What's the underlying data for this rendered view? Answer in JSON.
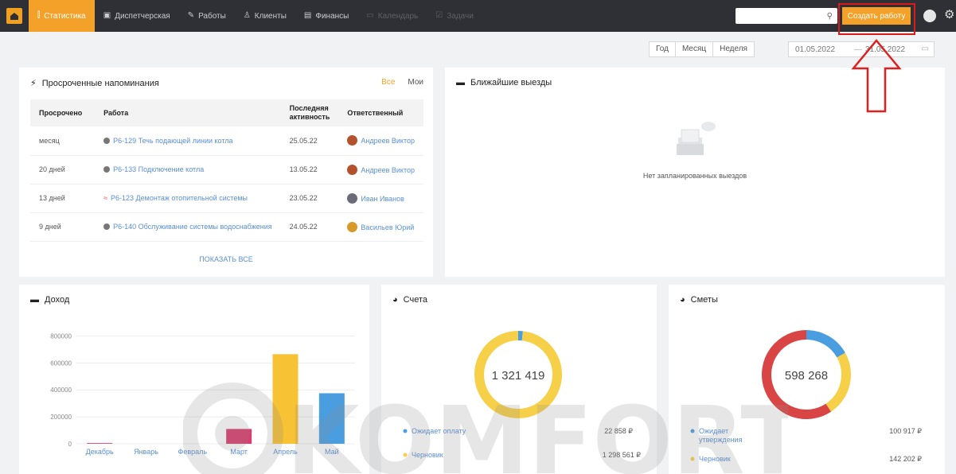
{
  "nav": {
    "items": [
      {
        "label": "Статистика",
        "icon": "chart-icon",
        "glyph": "⫿",
        "active": true
      },
      {
        "label": "Диспетчерская",
        "icon": "dispatch-icon",
        "glyph": "▣"
      },
      {
        "label": "Работы",
        "icon": "wrench-icon",
        "glyph": "✎"
      },
      {
        "label": "Клиенты",
        "icon": "person-icon",
        "glyph": "♙"
      },
      {
        "label": "Финансы",
        "icon": "finance-icon",
        "glyph": "▤"
      },
      {
        "label": "Календарь",
        "icon": "calendar-icon",
        "glyph": "▭",
        "disabled": true
      },
      {
        "label": "Задачи",
        "icon": "tasks-icon",
        "glyph": "☑",
        "disabled": true
      }
    ],
    "search_icon": "⚲",
    "create_label": "Создать работу",
    "gear_glyph": "⚙"
  },
  "filters": {
    "periods": [
      "Год",
      "Месяц",
      "Неделя"
    ],
    "date_from": "01.05.2022",
    "date_sep": "—",
    "date_to": "31.05.2022",
    "cal_glyph": "▭"
  },
  "overdue": {
    "title": "Просроченные напоминания",
    "icon_glyph": "⚡",
    "tab_all": "Все",
    "tab_mine": "Мои",
    "columns": [
      "Просрочено",
      "Работа",
      "Последняя активность",
      "Ответственный"
    ],
    "rows": [
      {
        "overdue": "месяц",
        "marker": "dot",
        "job": "Р6-129 Течь подающей линии котла",
        "last": "25.05.22",
        "who": "Андреев Виктор",
        "avatar_color": "#b5522e"
      },
      {
        "overdue": "20 дней",
        "marker": "dot",
        "job": "Р6-133 Подключение котла",
        "last": "13.05.22",
        "who": "Андреев Виктор",
        "avatar_color": "#b5522e"
      },
      {
        "overdue": "13 дней",
        "marker": "urgent",
        "job": "Р6-123 Демонтаж отопительной системы",
        "last": "23.05.22",
        "who": "Иван Иванов",
        "avatar_color": "#6b6b7a"
      },
      {
        "overdue": "9 дней",
        "marker": "dot",
        "job": "Р6-140 Обслуживание системы водоснабжения",
        "last": "24.05.22",
        "who": "Васильев Юрий",
        "avatar_color": "#d59a2a"
      }
    ],
    "urgent_glyph": "≈",
    "show_all": "ПОКАЗАТЬ ВСЕ"
  },
  "trips": {
    "title": "Ближайшие выезды",
    "icon_glyph": "▬",
    "empty_text": "Нет запланированных выездов"
  },
  "income": {
    "title": "Доход",
    "icon_glyph": "▬"
  },
  "chart_data": [
    {
      "type": "bar",
      "title": "Доход",
      "categories": [
        "Декабрь",
        "Январь",
        "Февраль",
        "Март",
        "Апрель",
        "Май"
      ],
      "values": [
        5000,
        0,
        0,
        110000,
        665000,
        375000
      ],
      "colors": [
        "#d93b6d",
        "#d93b6d",
        "#d93b6d",
        "#d93b6d",
        "#f7c233",
        "#4a9ee0"
      ],
      "yticks": [
        0,
        200000,
        400000,
        600000,
        800000
      ],
      "ylim": [
        0,
        850000
      ],
      "grid": true
    },
    {
      "type": "pie",
      "title": "Счета",
      "center_label": "1 321 419",
      "series": [
        {
          "name": "Ожидает оплату",
          "value": 22858,
          "display": "22 858 ₽",
          "color": "#4a9ee0"
        },
        {
          "name": "Черновик",
          "value": 1298561,
          "display": "1 298 561 ₽",
          "color": "#f7d04a"
        }
      ]
    },
    {
      "type": "pie",
      "title": "Сметы",
      "center_label": "598 268",
      "series": [
        {
          "name": "Ожидает утверждения",
          "value": 100917,
          "display": "100 917 ₽",
          "color": "#4a9ee0"
        },
        {
          "name": "Черновик",
          "value": 142202,
          "display": "142 202 ₽",
          "color": "#f7d04a"
        },
        {
          "name": "",
          "value": 355149,
          "display": "",
          "color": "#d94444"
        }
      ]
    }
  ],
  "invoices": {
    "title": "Счета",
    "icon_glyph": "◕"
  },
  "estimates": {
    "title": "Сметы",
    "icon_glyph": "◕"
  },
  "watermark": "KOMFORT",
  "colors": {
    "topbar": "#2f3035",
    "accent": "#f4a12a",
    "highlight": "#d81b1b",
    "link": "#5a8fd4"
  }
}
